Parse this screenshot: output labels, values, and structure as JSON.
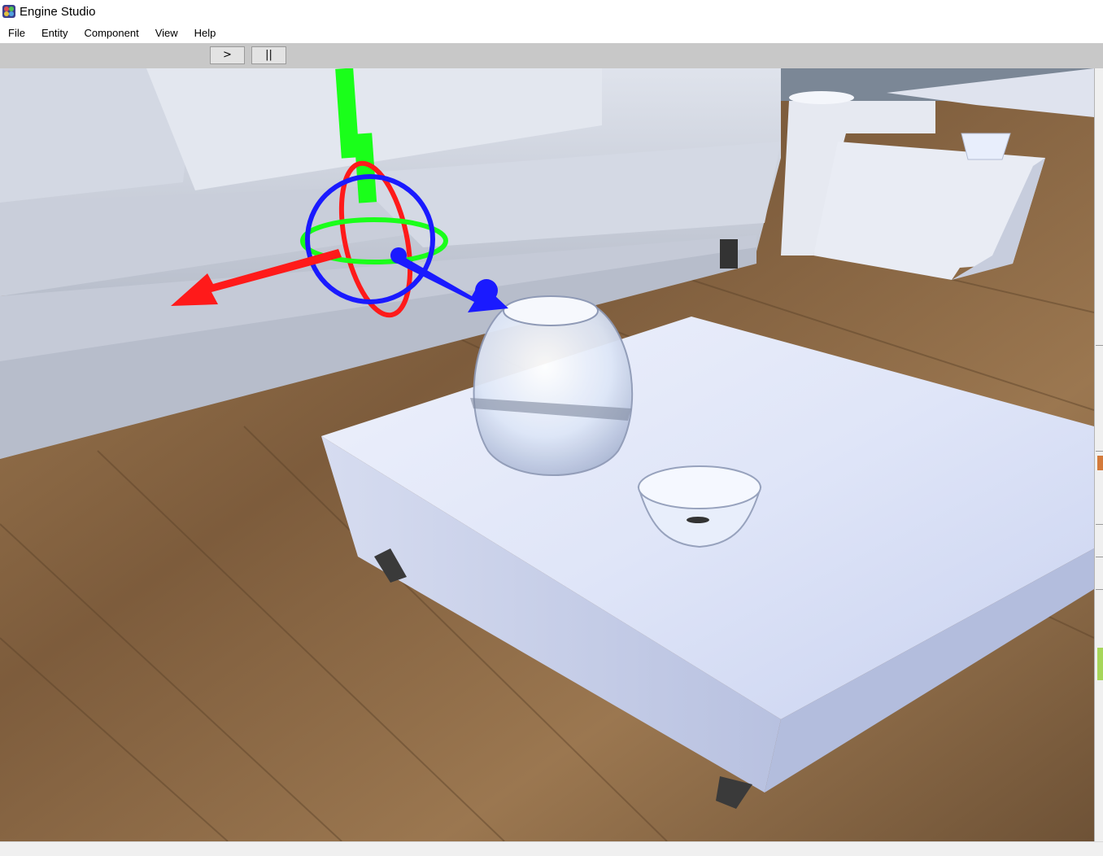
{
  "window": {
    "title": "Engine Studio"
  },
  "menu": {
    "items": [
      {
        "label": "File"
      },
      {
        "label": "Entity"
      },
      {
        "label": "Component"
      },
      {
        "label": "View"
      },
      {
        "label": "Help"
      }
    ]
  },
  "toolbar": {
    "play_label": ">",
    "pause_label": "||"
  },
  "viewport": {
    "scene": "living room with sofa, coffee table, glass vase and glass bowl",
    "gizmo": {
      "x_axis_color": "#ff1a1a",
      "y_axis_color": "#1aff1a",
      "z_axis_color": "#1a1aff"
    }
  },
  "colors": {
    "toolbar_bg": "#c8c8c8",
    "menubar_bg": "#ffffff",
    "floor_wood": "#8a6a45"
  }
}
